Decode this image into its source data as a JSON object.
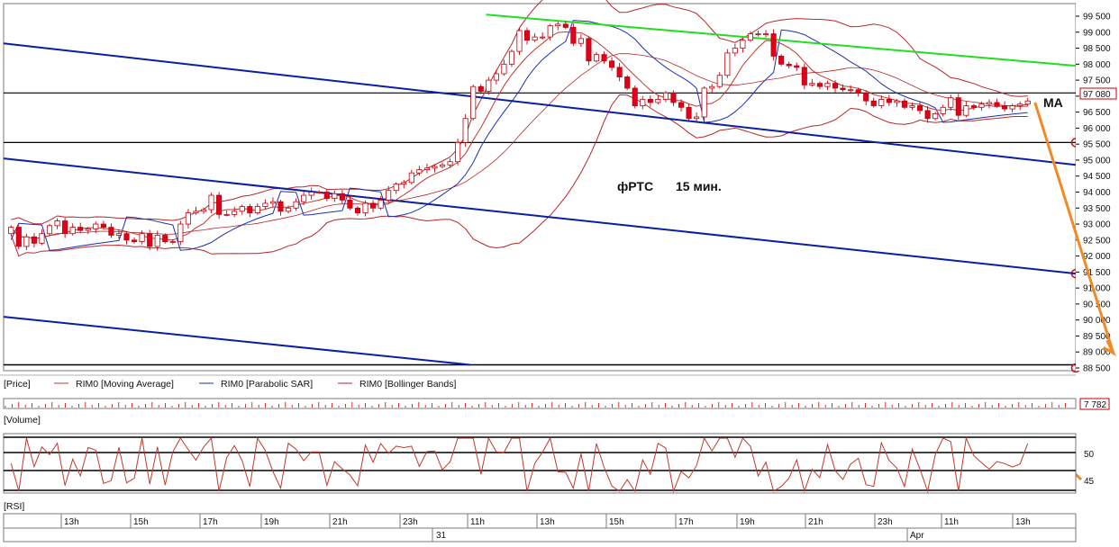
{
  "colors": {
    "bull_candle": "#ffffff",
    "bear_candle": "#e0001b",
    "candle_outline": "#c0000a",
    "moving_average": "#c0392b",
    "parabolic_sar": "#1a2fb0",
    "bollinger": "#b8262a",
    "channel": "#0a1fa0",
    "resistance": "#22dd22",
    "forecast": "#f08a24",
    "grid": "#555555"
  },
  "annotations": {
    "instrument": "фРТС",
    "timeframe": "15 мин.",
    "ma_label": "MA"
  },
  "price_tag": "97 080",
  "legend": [
    {
      "label": "[Price]",
      "color": "",
      "key": "price"
    },
    {
      "label": "RIM0 [Moving Average]",
      "color": "#c0392b",
      "key": "ma"
    },
    {
      "label": "RIM0 [Parabolic SAR]",
      "color": "#1a2fb0",
      "key": "sar"
    },
    {
      "label": "RIM0 [Bollinger Bands]",
      "color": "#b8262a",
      "key": "bb"
    }
  ],
  "volume_panel": {
    "label": "[Volume]",
    "value_tag": "7 782"
  },
  "rsi_panel": {
    "label": "[RSI]",
    "ticks": [
      "50",
      "45"
    ]
  },
  "time_axis": {
    "hours": [
      "13h",
      "15h",
      "17h",
      "19h",
      "21h",
      "23h",
      "11h",
      "13h",
      "15h",
      "17h",
      "19h",
      "21h",
      "23h",
      "11h",
      "13h"
    ],
    "dates": [
      "31",
      "Apr"
    ]
  },
  "chart_data": {
    "type": "candlestick",
    "title": "",
    "ylim": [
      88500,
      99500
    ],
    "y_ticks": [
      "99 500",
      "99 000",
      "98 500",
      "98 000",
      "97 500",
      "97 000",
      "96 500",
      "96 000",
      "95 500",
      "95 000",
      "94 500",
      "94 000",
      "93 500",
      "93 000",
      "92 500",
      "92 000",
      "91 500",
      "91 000",
      "90 500",
      "90 000",
      "89 500",
      "89 000",
      "88 500"
    ],
    "horizontal_levels": [
      97100,
      95550,
      88600
    ],
    "candles_close": [
      92900,
      92300,
      92600,
      92400,
      92700,
      92950,
      93100,
      92700,
      92900,
      92800,
      92850,
      93000,
      92900,
      92650,
      92700,
      92500,
      92450,
      92700,
      92300,
      92650,
      92450,
      92450,
      93000,
      93350,
      93400,
      93450,
      93900,
      93300,
      93300,
      93400,
      93550,
      93350,
      93550,
      93650,
      93700,
      93400,
      93500,
      93700,
      93900,
      94000,
      94000,
      93800,
      93950,
      93750,
      93500,
      93350,
      93650,
      93500,
      93750,
      94050,
      94250,
      94300,
      94600,
      94700,
      94750,
      94800,
      94850,
      94950,
      95550,
      96300,
      97300,
      97150,
      97500,
      97700,
      98000,
      98400,
      99050,
      98750,
      98850,
      98850,
      99200,
      99250,
      99150,
      98650,
      98800,
      98100,
      98300,
      98100,
      97900,
      97600,
      97250,
      96700,
      96900,
      96800,
      96900,
      97100,
      96800,
      96650,
      96300,
      96350,
      97250,
      97300,
      97650,
      98350,
      98500,
      98750,
      98950,
      98950,
      98950,
      98250,
      98000,
      97950,
      97900,
      97350,
      97400,
      97300,
      97400,
      97250,
      97200,
      97200,
      97100,
      96850,
      96700,
      96900,
      96800,
      96850,
      96650,
      96700,
      96550,
      96300,
      96450,
      96650,
      96950,
      96400,
      96700,
      96650,
      96750,
      96800,
      96700,
      96600,
      96700,
      96750,
      96850
    ],
    "candles_open": [
      92700,
      92900,
      92300,
      92600,
      92400,
      92700,
      92950,
      93100,
      92700,
      92900,
      92800,
      92850,
      93000,
      92900,
      92650,
      92700,
      92500,
      92450,
      92700,
      92300,
      92650,
      92450,
      92450,
      93000,
      93350,
      93400,
      93450,
      93900,
      93300,
      93300,
      93400,
      93550,
      93350,
      93550,
      93650,
      93700,
      93400,
      93500,
      93700,
      93900,
      94000,
      94000,
      93800,
      93950,
      93750,
      93500,
      93350,
      93650,
      93500,
      93750,
      94050,
      94250,
      94300,
      94600,
      94700,
      94750,
      94800,
      94850,
      94950,
      95550,
      96300,
      97300,
      97150,
      97500,
      97700,
      98000,
      98400,
      99050,
      98750,
      98850,
      98850,
      99200,
      99250,
      99150,
      98650,
      98800,
      98100,
      98300,
      98100,
      97900,
      97600,
      97250,
      96700,
      96900,
      96800,
      96900,
      97100,
      96800,
      96650,
      96300,
      96350,
      97250,
      97300,
      97650,
      98350,
      98500,
      98750,
      98950,
      98950,
      98950,
      98250,
      98000,
      97950,
      97900,
      97350,
      97400,
      97300,
      97400,
      97250,
      97200,
      97200,
      97100,
      96850,
      96700,
      96900,
      96800,
      96850,
      96650,
      96700,
      96550,
      96300,
      96450,
      96650,
      96950,
      96400,
      96700,
      96650,
      96750,
      96800,
      96700,
      96600,
      96700,
      96750
    ],
    "channel_lines": [
      {
        "from": [
          0,
          98650
        ],
        "to": [
          1,
          94850
        ]
      },
      {
        "from": [
          0,
          95050
        ],
        "to": [
          1,
          91450
        ]
      },
      {
        "from": [
          0,
          90100
        ],
        "to": [
          0.435,
          88600
        ]
      }
    ],
    "resistance_line": {
      "from": [
        0.45,
        99550
      ],
      "to": [
        1,
        97950
      ]
    },
    "forecast_line": {
      "from": [
        0.962,
        96800
      ],
      "to": [
        1.035,
        88800
      ]
    }
  }
}
